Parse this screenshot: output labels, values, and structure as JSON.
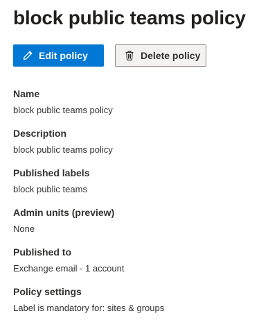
{
  "page": {
    "title": "block public teams policy"
  },
  "toolbar": {
    "edit_label": "Edit policy",
    "edit_icon": "pencil-icon",
    "delete_label": "Delete policy",
    "delete_icon": "trash-icon",
    "primary_color": "#0078d4"
  },
  "details": [
    {
      "label": "Name",
      "value": "block public teams policy"
    },
    {
      "label": "Description",
      "value": "block public teams policy"
    },
    {
      "label": "Published labels",
      "value": "block public teams"
    },
    {
      "label": "Admin units (preview)",
      "value": "None"
    },
    {
      "label": "Published to",
      "value": "Exchange email - 1 account"
    },
    {
      "label": "Policy settings",
      "value": "Label is mandatory for: sites & groups"
    }
  ]
}
